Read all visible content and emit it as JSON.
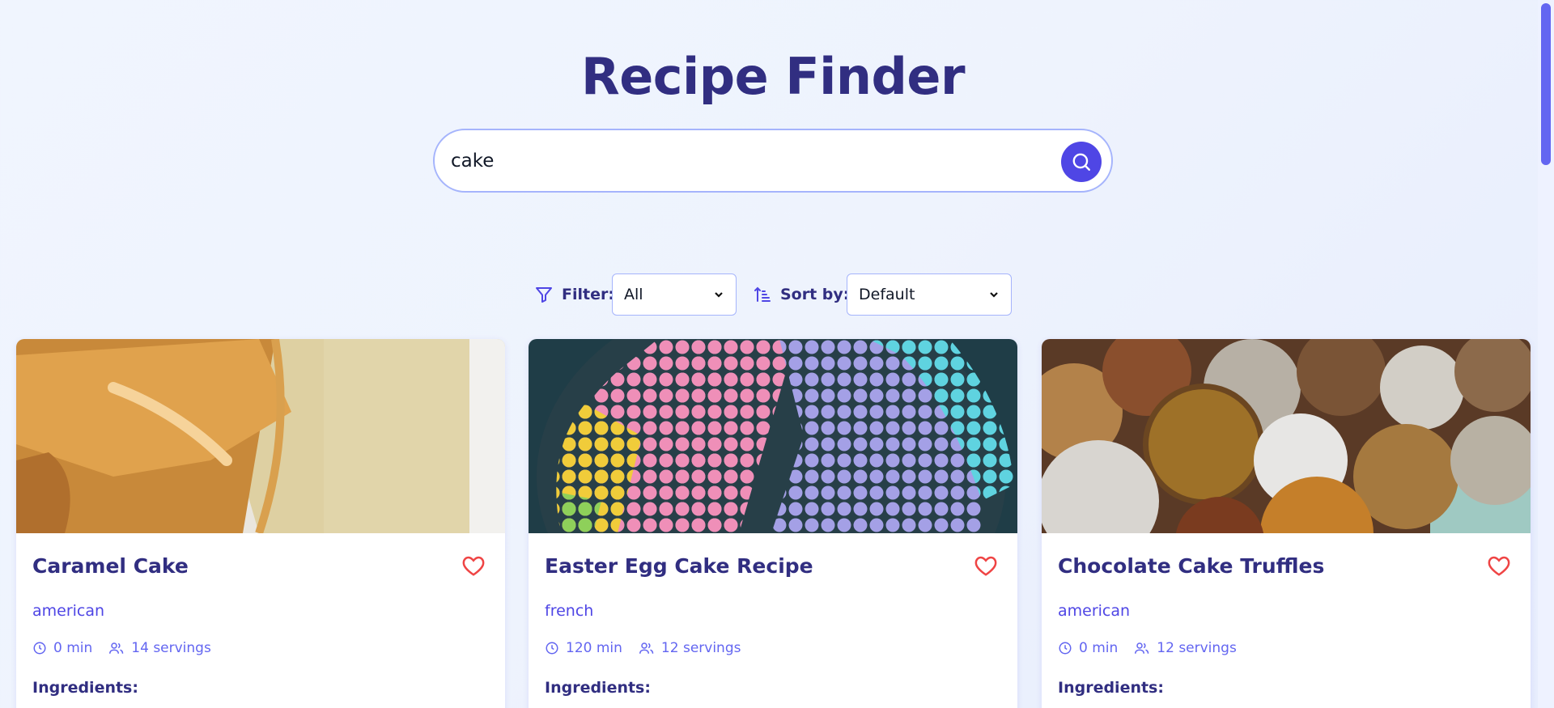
{
  "app": {
    "title": "Recipe Finder"
  },
  "search": {
    "value": "cake",
    "placeholder": ""
  },
  "controls": {
    "filter_label": "Filter:",
    "filter_value": "All",
    "sort_label": "Sort by:",
    "sort_value": "Default"
  },
  "colors": {
    "accent": "#4f46e5",
    "title": "#312e81",
    "heart": "#ef4444"
  },
  "cards": [
    {
      "title": "Caramel Cake",
      "cuisine": "american",
      "time": "0 min",
      "servings": "14 servings",
      "ingredients_label": "Ingredients:"
    },
    {
      "title": "Easter Egg Cake Recipe",
      "cuisine": "french",
      "time": "120 min",
      "servings": "12 servings",
      "ingredients_label": "Ingredients:"
    },
    {
      "title": "Chocolate Cake Truffles",
      "cuisine": "american",
      "time": "0 min",
      "servings": "12 servings",
      "ingredients_label": "Ingredients:"
    }
  ]
}
